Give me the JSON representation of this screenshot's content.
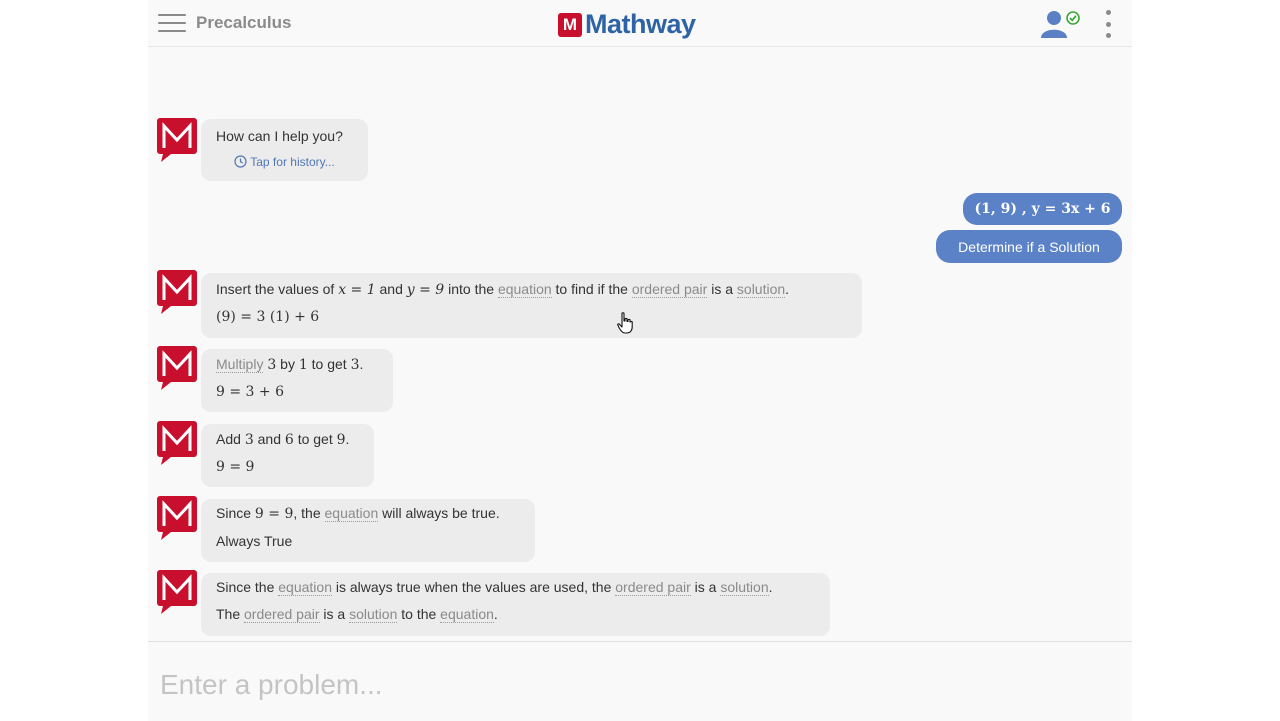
{
  "header": {
    "subject": "Precalculus",
    "brand": "Mathway",
    "brand_letter": "M"
  },
  "greeting": {
    "text": "How can I help you?",
    "history_link": "Tap for history..."
  },
  "user_message": {
    "expression": "(1, 9) , y = 3x + 6",
    "action": "Determine if a Solution"
  },
  "steps": [
    {
      "t1": "Insert the values of",
      "x_eq": "x = 1",
      "and": "and",
      "y_eq": "y = 9",
      "into": "into the",
      "equation": "equation",
      "to_find": "to find if the",
      "ordered_pair": "ordered pair",
      "is_a": "is a",
      "solution": "solution",
      "period": ".",
      "math": "(9) = 3 (1) + 6"
    },
    {
      "multiply": "Multiply",
      "a": "3",
      "by": "by",
      "b": "1",
      "to_get": "to get",
      "c": "3",
      "period": ".",
      "math": "9 = 3 + 6"
    },
    {
      "add": "Add",
      "a": "3",
      "and": "and",
      "b": "6",
      "to_get": "to get",
      "c": "9",
      "period": ".",
      "math": "9 = 9"
    },
    {
      "since": "Since",
      "math_inline": "9 = 9",
      "comma_the": ", the",
      "equation": "equation",
      "rest": "will always be true.",
      "result": "Always True"
    },
    {
      "l1_a": "Since the",
      "l1_equation": "equation",
      "l1_b": "is always true when the values are used, the",
      "l1_ordered_pair": "ordered pair",
      "l1_c": "is a",
      "l1_solution": "solution",
      "l1_d": ".",
      "l2_a": "The",
      "l2_ordered_pair": "ordered pair",
      "l2_b": "is a",
      "l2_solution": "solution",
      "l2_c": "to the",
      "l2_equation": "equation",
      "l2_d": "."
    }
  ],
  "input": {
    "placeholder": "Enter a problem..."
  },
  "colors": {
    "brand_red": "#c8102e",
    "brand_blue": "#2e64a6",
    "user_bubble": "#5b82c6",
    "check_green": "#3aaa35"
  }
}
